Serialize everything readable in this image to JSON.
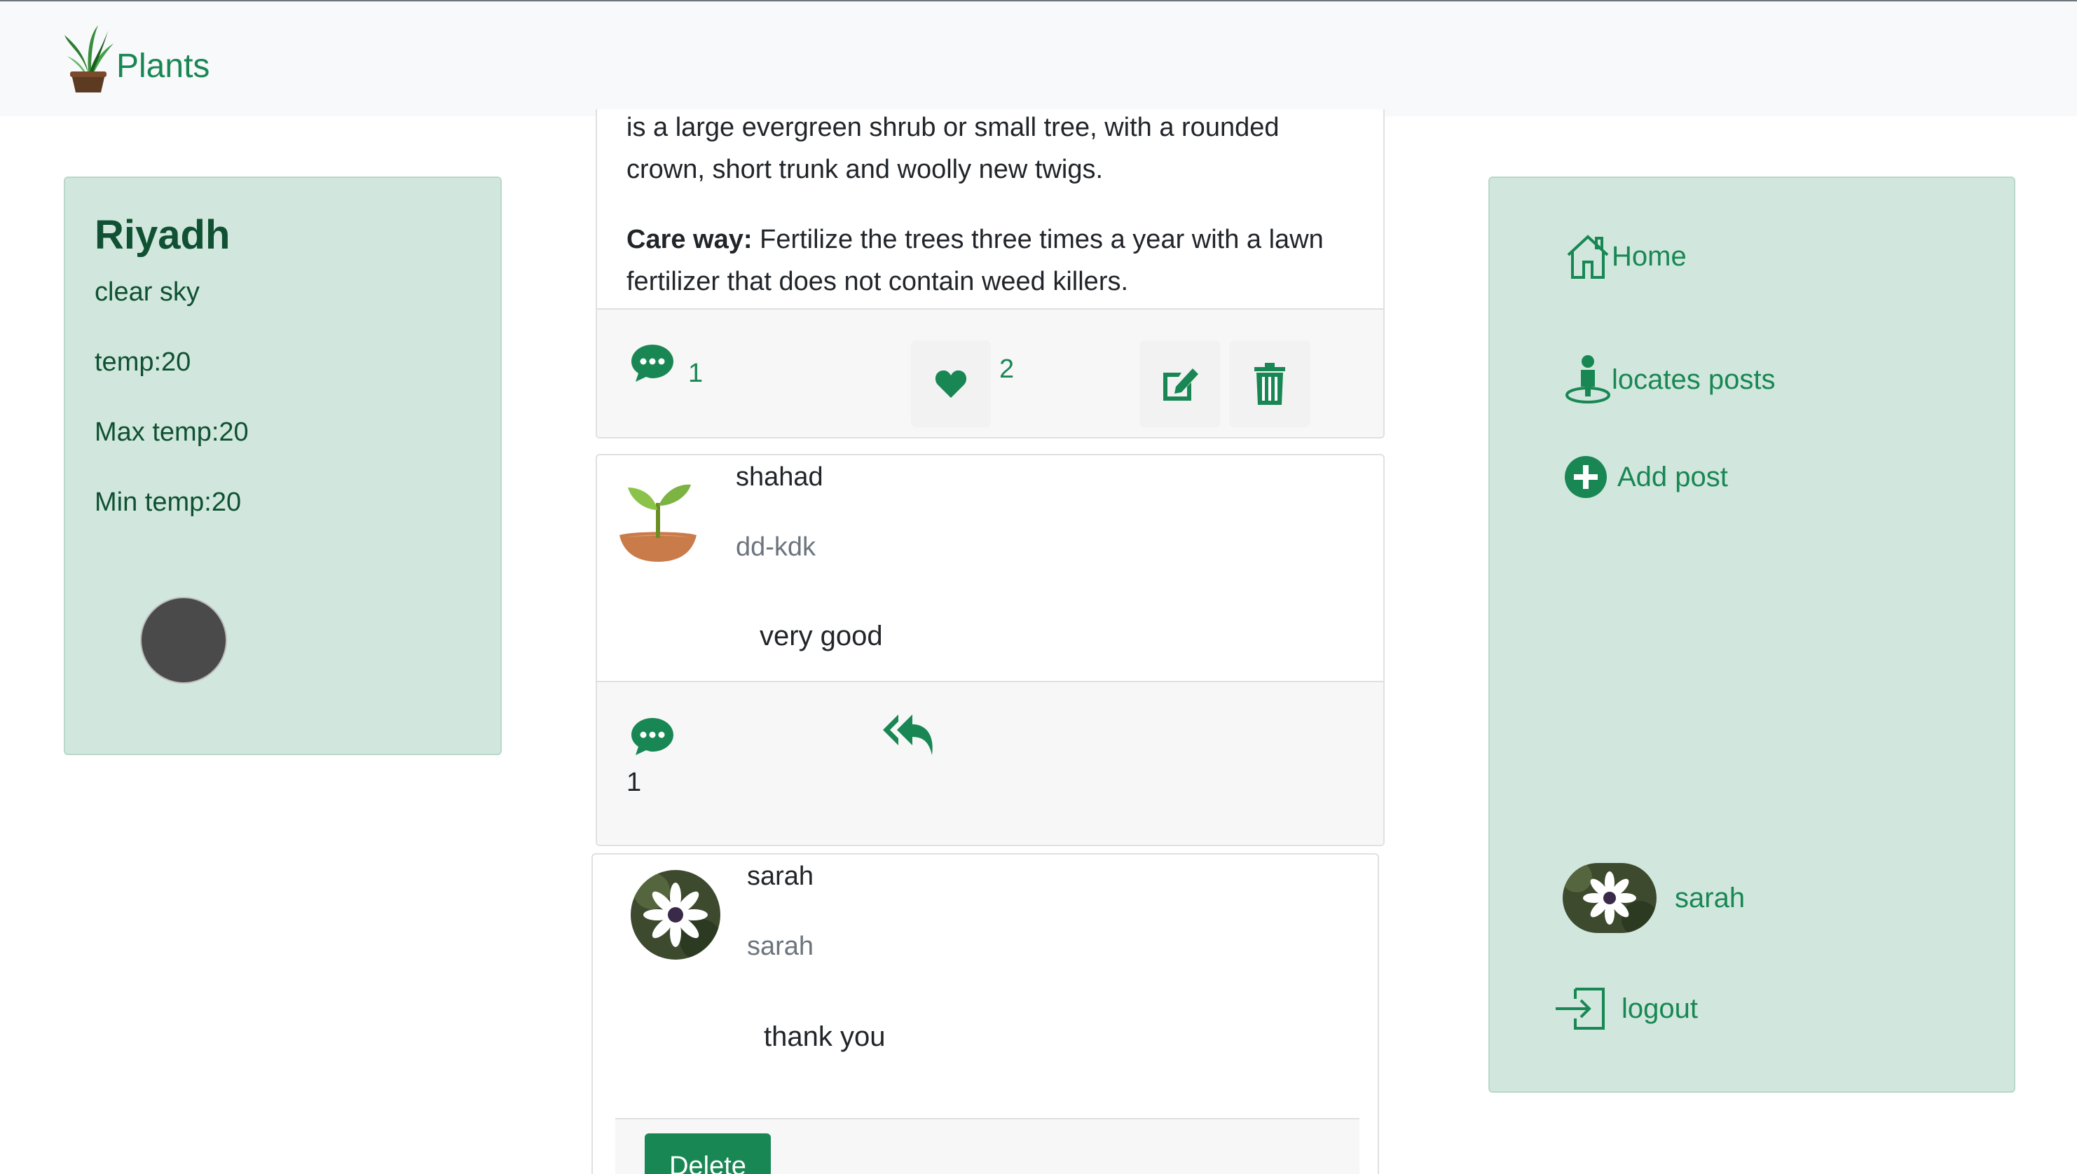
{
  "brand": {
    "name": "Plants"
  },
  "weather": {
    "city": "Riyadh",
    "description": "clear sky",
    "temp": "temp:20",
    "max_temp": "Max temp:20",
    "min_temp": "Min temp:20"
  },
  "post": {
    "description_tail_1": "is a large evergreen shrub or small tree, with a rounded",
    "description_tail_2": "crown, short trunk and woolly new twigs.",
    "care_label": "Care way:",
    "care_text_1": " Fertilize the trees three times a year with a lawn",
    "care_text_2": "fertilizer that does not contain weed killers.",
    "comment_count": "1",
    "like_count": "2"
  },
  "comments": [
    {
      "name": "shahad",
      "handle": "dd-kdk",
      "text": "very good",
      "reply_count": "1"
    }
  ],
  "replies": [
    {
      "name": "sarah",
      "handle": "sarah",
      "text": "thank you",
      "delete_label": "Delete"
    }
  ],
  "nav": {
    "home": "Home",
    "locates_posts": "locates posts",
    "add_post": "Add post",
    "user_name": "sarah",
    "logout": "logout"
  },
  "colors": {
    "accent": "#198754",
    "panel": "#d1e7dd",
    "navbar": "#f8f9fa"
  },
  "icons": [
    "plant-logo-icon",
    "comment-icon",
    "heart-icon",
    "edit-icon",
    "trash-icon",
    "reply-all-icon",
    "home-icon",
    "person-pin-icon",
    "plus-circle-icon",
    "logout-icon"
  ]
}
